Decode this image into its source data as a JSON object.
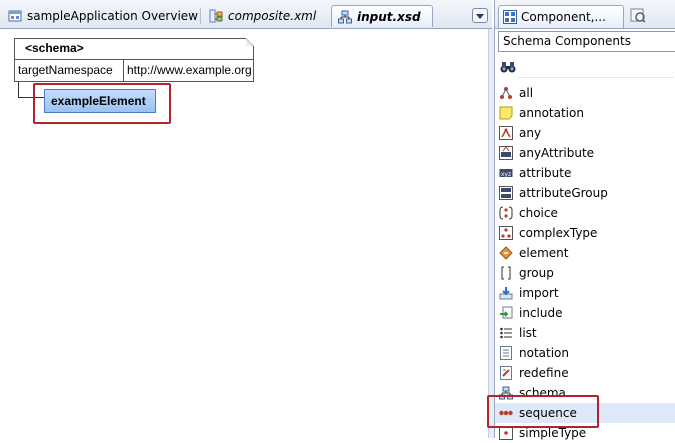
{
  "editor_tabs": [
    {
      "label": "sampleApplication Overview",
      "icon": "overview-icon"
    },
    {
      "label": "composite.xml",
      "icon": "composite-icon"
    },
    {
      "label": "input.xsd",
      "icon": "xsd-icon",
      "active": true
    }
  ],
  "canvas": {
    "schema": {
      "title": "<schema>",
      "attribute_name": "targetNamespace",
      "attribute_value": "http://www.example.org"
    },
    "element": {
      "label": "exampleElement"
    }
  },
  "palette": {
    "tab_label": "Component,...",
    "category": "Schema Components",
    "search_value": "",
    "items": [
      {
        "label": "all",
        "icon": "all-icon"
      },
      {
        "label": "annotation",
        "icon": "annotation-icon"
      },
      {
        "label": "any",
        "icon": "any-icon"
      },
      {
        "label": "anyAttribute",
        "icon": "anyattribute-icon"
      },
      {
        "label": "attribute",
        "icon": "attribute-icon"
      },
      {
        "label": "attributeGroup",
        "icon": "attributegroup-icon"
      },
      {
        "label": "choice",
        "icon": "choice-icon"
      },
      {
        "label": "complexType",
        "icon": "complextype-icon"
      },
      {
        "label": "element",
        "icon": "element-icon"
      },
      {
        "label": "group",
        "icon": "group-icon"
      },
      {
        "label": "import",
        "icon": "import-icon"
      },
      {
        "label": "include",
        "icon": "include-icon"
      },
      {
        "label": "list",
        "icon": "list-icon"
      },
      {
        "label": "notation",
        "icon": "notation-icon"
      },
      {
        "label": "redefine",
        "icon": "redefine-icon"
      },
      {
        "label": "schema",
        "icon": "schema-icon"
      },
      {
        "label": "sequence",
        "icon": "sequence-icon",
        "selected": true
      },
      {
        "label": "simpleType",
        "icon": "simpletype-icon"
      }
    ]
  },
  "colors": {
    "highlight": "#b0252d",
    "element_fill": "#9cc2f2",
    "selection": "#dde9f8"
  }
}
